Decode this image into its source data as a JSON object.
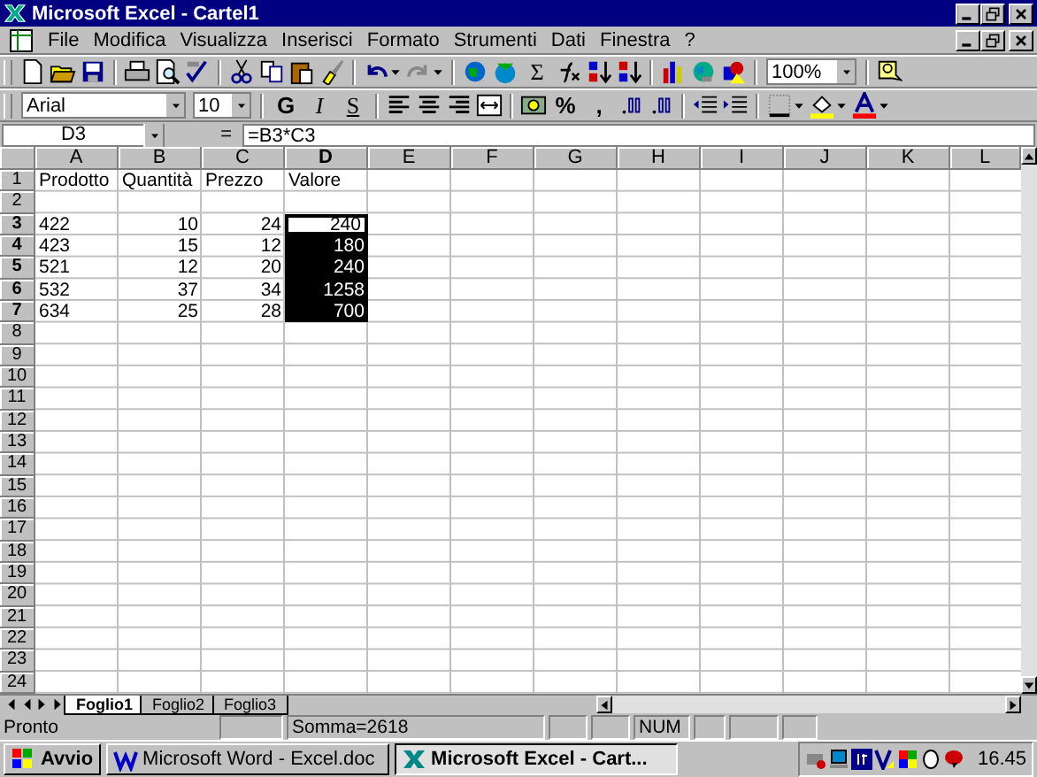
{
  "window": {
    "title": "Microsoft Excel - Cartel1"
  },
  "menu": [
    {
      "label": "File"
    },
    {
      "label": "Modifica"
    },
    {
      "label": "Visualizza"
    },
    {
      "label": "Inserisci"
    },
    {
      "label": "Formato"
    },
    {
      "label": "Strumenti"
    },
    {
      "label": "Dati"
    },
    {
      "label": "Finestra"
    },
    {
      "label": "?"
    }
  ],
  "standard_toolbar": {
    "sum": "Σ",
    "zoom": "100%"
  },
  "format_toolbar": {
    "font": "Arial",
    "size": "10",
    "bold": "G",
    "italic": "I",
    "underline": "S",
    "percent": "%",
    "comma": ","
  },
  "formula_bar": {
    "name_box": "D3",
    "equals": "=",
    "formula": "=B3*C3"
  },
  "sheet": {
    "columns": [
      {
        "label": "A",
        "selected": false
      },
      {
        "label": "B",
        "selected": false
      },
      {
        "label": "C",
        "selected": false
      },
      {
        "label": "D",
        "selected": true
      },
      {
        "label": "E",
        "selected": false
      },
      {
        "label": "F",
        "selected": false
      },
      {
        "label": "G",
        "selected": false
      },
      {
        "label": "H",
        "selected": false
      },
      {
        "label": "I",
        "selected": false
      },
      {
        "label": "J",
        "selected": false
      },
      {
        "label": "K",
        "selected": false
      },
      {
        "label": "L",
        "selected": false
      }
    ],
    "rows": [
      {
        "label": "1",
        "selected": false,
        "cells": [
          {
            "text": "Prodotto",
            "kind": "text",
            "selected": false,
            "active": false
          },
          {
            "text": "Quantità",
            "kind": "text",
            "selected": false,
            "active": false
          },
          {
            "text": "Prezzo",
            "kind": "text",
            "selected": false,
            "active": false
          },
          {
            "text": "Valore",
            "kind": "text",
            "selected": false,
            "active": false
          }
        ]
      },
      {
        "label": "2",
        "selected": false
      },
      {
        "label": "3",
        "selected": true,
        "cells": [
          {
            "text": "422",
            "kind": "text",
            "selected": false,
            "active": false
          },
          {
            "text": "10",
            "kind": "number",
            "selected": false,
            "active": false
          },
          {
            "text": "24",
            "kind": "number",
            "selected": false,
            "active": false
          },
          {
            "text": "240",
            "kind": "number",
            "selected": true,
            "active": true
          }
        ]
      },
      {
        "label": "4",
        "selected": true,
        "cells": [
          {
            "text": "423",
            "kind": "text",
            "selected": false,
            "active": false
          },
          {
            "text": "15",
            "kind": "number",
            "selected": false,
            "active": false
          },
          {
            "text": "12",
            "kind": "number",
            "selected": false,
            "active": false
          },
          {
            "text": "180",
            "kind": "number",
            "selected": true,
            "active": false
          }
        ]
      },
      {
        "label": "5",
        "selected": true,
        "cells": [
          {
            "text": "521",
            "kind": "text",
            "selected": false,
            "active": false
          },
          {
            "text": "12",
            "kind": "number",
            "selected": false,
            "active": false
          },
          {
            "text": "20",
            "kind": "number",
            "selected": false,
            "active": false
          },
          {
            "text": "240",
            "kind": "number",
            "selected": true,
            "active": false
          }
        ]
      },
      {
        "label": "6",
        "selected": true,
        "cells": [
          {
            "text": "532",
            "kind": "text",
            "selected": false,
            "active": false
          },
          {
            "text": "37",
            "kind": "number",
            "selected": false,
            "active": false
          },
          {
            "text": "34",
            "kind": "number",
            "selected": false,
            "active": false
          },
          {
            "text": "1258",
            "kind": "number",
            "selected": true,
            "active": false
          }
        ]
      },
      {
        "label": "7",
        "selected": true,
        "cells": [
          {
            "text": "634",
            "kind": "text",
            "selected": false,
            "active": false
          },
          {
            "text": "25",
            "kind": "number",
            "selected": false,
            "active": false
          },
          {
            "text": "28",
            "kind": "number",
            "selected": false,
            "active": false
          },
          {
            "text": "700",
            "kind": "number",
            "selected": true,
            "active": false
          }
        ]
      },
      {
        "label": "8",
        "selected": false
      },
      {
        "label": "9",
        "selected": false
      },
      {
        "label": "10",
        "selected": false
      },
      {
        "label": "11",
        "selected": false
      },
      {
        "label": "12",
        "selected": false
      },
      {
        "label": "13",
        "selected": false
      },
      {
        "label": "14",
        "selected": false
      },
      {
        "label": "15",
        "selected": false
      },
      {
        "label": "16",
        "selected": false
      },
      {
        "label": "17",
        "selected": false
      },
      {
        "label": "18",
        "selected": false
      },
      {
        "label": "19",
        "selected": false
      },
      {
        "label": "20",
        "selected": false
      },
      {
        "label": "21",
        "selected": false
      },
      {
        "label": "22",
        "selected": false
      },
      {
        "label": "23",
        "selected": false
      },
      {
        "label": "24",
        "selected": false
      }
    ]
  },
  "sheet_tabs": [
    {
      "label": "Foglio1",
      "selected": true
    },
    {
      "label": "Foglio2",
      "selected": false
    },
    {
      "label": "Foglio3",
      "selected": false
    }
  ],
  "status_bar": {
    "message": "Pronto",
    "sum": "Somma=2618",
    "num": "NUM"
  },
  "taskbar": {
    "start": "Avvio",
    "tasks": [
      {
        "label": "Microsoft Word - Excel.doc",
        "kind": "word",
        "selected": false
      },
      {
        "label": "Microsoft Excel - Cart...",
        "kind": "excel",
        "selected": true
      }
    ],
    "clock": "16.45"
  }
}
